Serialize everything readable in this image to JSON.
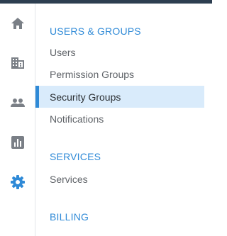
{
  "nav": {
    "icons": [
      {
        "name": "home-icon",
        "color": "#7a7f86"
      },
      {
        "name": "building-icon",
        "color": "#7a7f86"
      },
      {
        "name": "people-icon",
        "color": "#7a7f86"
      },
      {
        "name": "bar-chart-icon",
        "color": "#7a7f86"
      },
      {
        "name": "gear-icon",
        "color": "#2f8ad7",
        "active": true
      }
    ]
  },
  "menu": {
    "sections": [
      {
        "title": "USERS & GROUPS",
        "items": [
          {
            "label": "Users"
          },
          {
            "label": "Permission Groups"
          },
          {
            "label": "Security Groups",
            "active": true
          },
          {
            "label": "Notifications"
          }
        ]
      },
      {
        "title": "SERVICES",
        "items": [
          {
            "label": "Services"
          }
        ]
      },
      {
        "title": "BILLING",
        "items": []
      }
    ]
  },
  "colors": {
    "accent": "#2f8ad7",
    "active_background": "#d9ebfb",
    "topbar": "#2d3e50"
  }
}
